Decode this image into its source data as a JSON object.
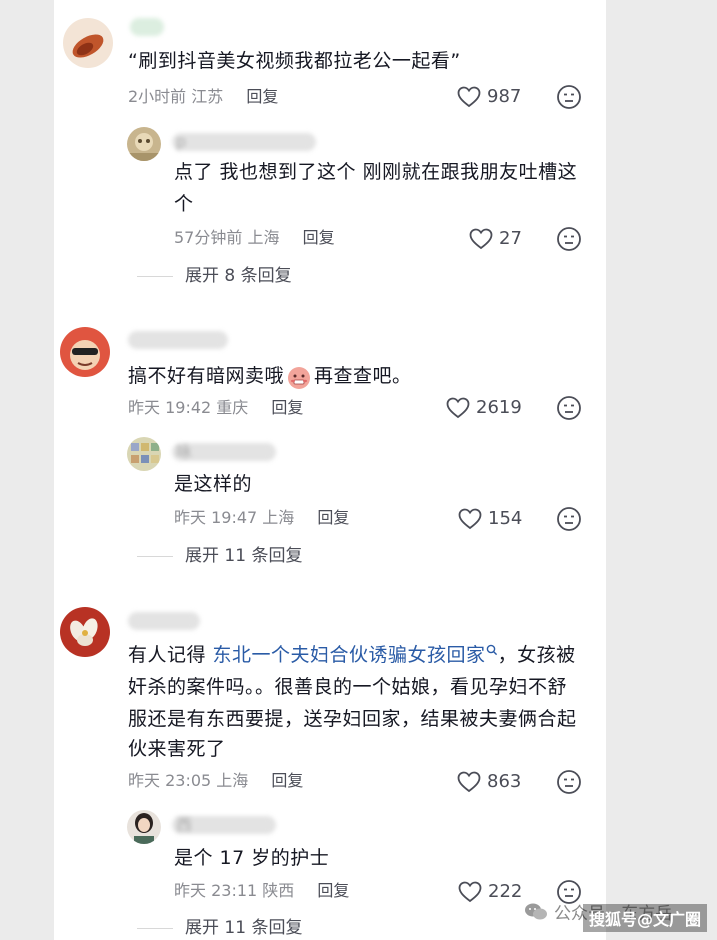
{
  "comments": [
    {
      "text": "“刷到抖音美女视频我都拉老公一起看”",
      "time": "2小时前",
      "location": "江苏",
      "reply_label": "回复",
      "likes": "987",
      "replies": [
        {
          "name": "p",
          "text_line1": "点了 我也想到了这个 刚刚就在跟我朋友吐槽这",
          "text_line2": "个",
          "time": "57分钟前",
          "location": "上海",
          "reply_label": "回复",
          "likes": "27"
        }
      ],
      "expand_label": "展开 8 条回复"
    },
    {
      "text_before": "搞不好有暗网卖哦",
      "text_after": "再查查吧。",
      "time": "昨天 19:42",
      "location": "重庆",
      "reply_label": "回复",
      "likes": "2619",
      "replies": [
        {
          "name": "咏",
          "text": "是这样的",
          "time": "昨天 19:47",
          "location": "上海",
          "reply_label": "回复",
          "likes": "154"
        }
      ],
      "expand_label": "展开 11 条回复"
    },
    {
      "text_prefix": "有人记得 ",
      "link_text": "东北一个夫妇合伙诱骗女孩回家",
      "text_line1_suffix": "，女孩被",
      "text_line2": "奸杀的案件吗。。很善良的一个姑娘，看见孕妇不舒",
      "text_line3": "服还是有东西要提，送孕妇回家，结果被夫妻俩合起",
      "text_line4": "伙来害死了",
      "time": "昨天 23:05",
      "location": "上海",
      "reply_label": "回复",
      "likes": "863",
      "replies": [
        {
          "name": "西",
          "text": "是个 17 岁的护士",
          "time": "昨天 23:11",
          "location": "陕西",
          "reply_label": "回复",
          "likes": "222"
        }
      ],
      "expand_label": "展开 11 条回复"
    }
  ],
  "watermark": {
    "text": "公众号 · 东方岳",
    "site": "搜狐号@文广圈"
  },
  "icons": {
    "like": "heart-outline-icon",
    "dislike": "unhappy-face-icon",
    "search": "search-small-icon"
  },
  "colors": {
    "link": "#2a5ba6",
    "meta": "#8a8b91"
  }
}
